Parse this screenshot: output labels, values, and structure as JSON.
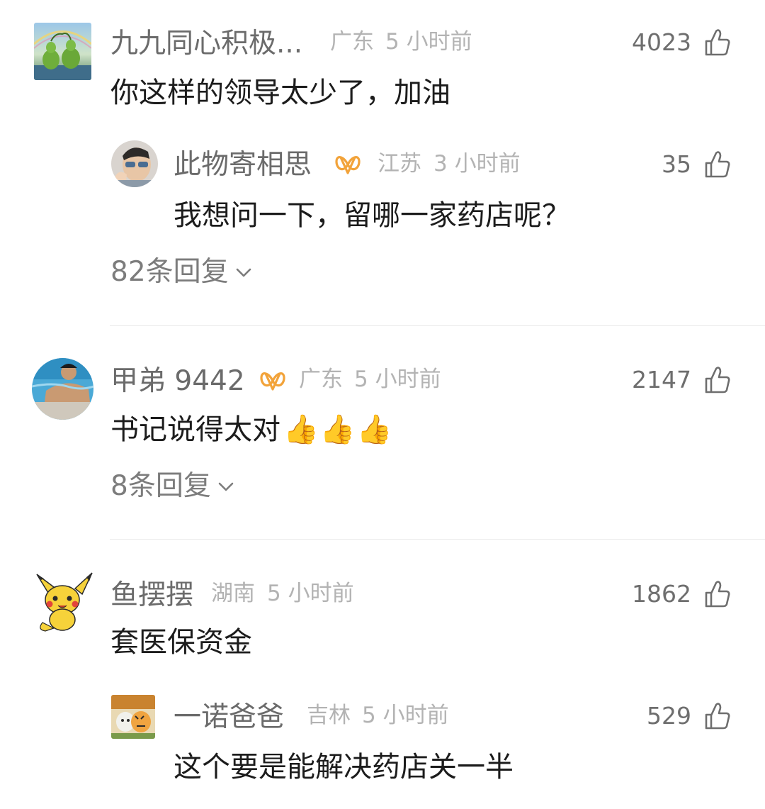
{
  "comments": [
    {
      "name": "九九同心积极...",
      "location": "广东",
      "time": "5 小时前",
      "likes": "4023",
      "text": "你这样的领导太少了，加油",
      "replies_label": "82条回复",
      "reply": {
        "name": "此物寄相思",
        "location": "江苏",
        "time": "3 小时前",
        "likes": "35",
        "text": "我想问一下，留哪一家药店呢？"
      }
    },
    {
      "name": "甲弟 9442",
      "location": "广东",
      "time": "5 小时前",
      "likes": "2147",
      "text": "书记说得太对",
      "emojis": "👍👍👍",
      "replies_label": "8条回复"
    },
    {
      "name": "鱼摆摆",
      "location": "湖南",
      "time": "5 小时前",
      "likes": "1862",
      "text": "套医保资金",
      "reply": {
        "name": "一诺爸爸",
        "location": "吉林",
        "time": "5 小时前",
        "likes": "529",
        "text": "这个要是能解决药店关一半"
      }
    }
  ],
  "colors": {
    "name": "#6b6b6b",
    "meta": "#b3b3b3",
    "vip_badge": "#f2a33a",
    "divider": "#e9e9e9"
  },
  "icons": {
    "like": "thumbs-up-outline-icon",
    "vip": "vip-badge-icon",
    "expand": "chevron-down-icon"
  }
}
